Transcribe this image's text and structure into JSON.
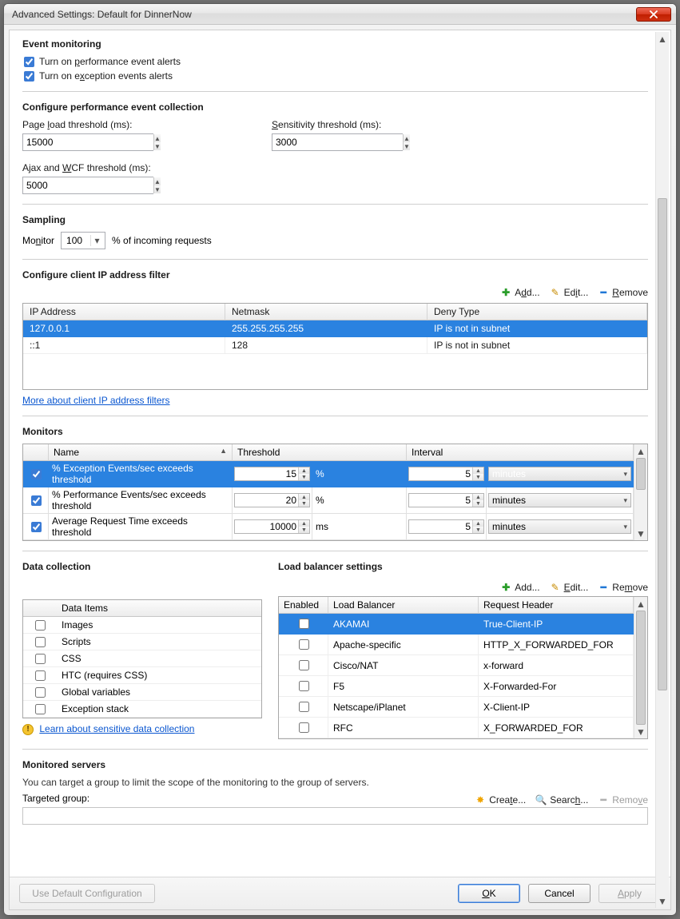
{
  "titlebar": {
    "title": "Advanced Settings: Default for DinnerNow"
  },
  "sections": {
    "event_monitoring": {
      "heading": "Event monitoring",
      "perf_alerts": "Turn on performance event alerts",
      "perf_alerts_uchar": "p",
      "exc_alerts": "Turn on exception events alerts",
      "exc_alerts_uchar": "x"
    },
    "perf_collection": {
      "heading": "Configure performance event collection",
      "page_load_label": "Page load threshold (ms):",
      "page_load_value": "15000",
      "sensitivity_label": "Sensitivity threshold (ms):",
      "sensitivity_value": "3000",
      "ajax_label": "Ajax and WCF threshold (ms):",
      "ajax_value": "5000"
    },
    "sampling": {
      "heading": "Sampling",
      "monitor_label": "Monitor",
      "monitor_value": "100",
      "suffix": "% of incoming requests"
    },
    "ip_filter": {
      "heading": "Configure client IP address filter",
      "actions": {
        "add": "Add...",
        "edit": "Edit...",
        "remove": "Remove"
      },
      "cols": {
        "ip": "IP Address",
        "netmask": "Netmask",
        "deny": "Deny Type"
      },
      "rows": [
        {
          "ip": "127.0.0.1",
          "netmask": "255.255.255.255",
          "deny": "IP is not in subnet"
        },
        {
          "ip": "::1",
          "netmask": "128",
          "deny": "IP is not in subnet"
        }
      ],
      "link": "More about client IP address filters"
    },
    "monitors": {
      "heading": "Monitors",
      "cols": {
        "name": "Name",
        "threshold": "Threshold",
        "interval": "Interval"
      },
      "rows": [
        {
          "checked": true,
          "name": "% Exception Events/sec exceeds threshold",
          "threshold": "15",
          "unit": "%",
          "interval": "5",
          "interval_unit": "minutes",
          "selected": true
        },
        {
          "checked": true,
          "name": "% Performance Events/sec exceeds threshold",
          "threshold": "20",
          "unit": "%",
          "interval": "5",
          "interval_unit": "minutes",
          "selected": false
        },
        {
          "checked": true,
          "name": "Average Request Time exceeds threshold",
          "threshold": "10000",
          "unit": "ms",
          "interval": "5",
          "interval_unit": "minutes",
          "selected": false
        }
      ]
    },
    "data_collection": {
      "heading": "Data collection",
      "col": "Data Items",
      "items": [
        "Images",
        "Scripts",
        "CSS",
        "HTC (requires CSS)",
        "Global variables",
        "Exception stack"
      ],
      "link": "Learn about sensitive data collection"
    },
    "load_balancer": {
      "heading": "Load balancer settings",
      "actions": {
        "add": "Add...",
        "edit": "Edit...",
        "remove": "Remove"
      },
      "cols": {
        "enabled": "Enabled",
        "lb": "Load Balancer",
        "header": "Request Header"
      },
      "rows": [
        {
          "enabled": false,
          "lb": "AKAMAI",
          "header": "True-Client-IP",
          "selected": true
        },
        {
          "enabled": false,
          "lb": "Apache-specific",
          "header": "HTTP_X_FORWARDED_FOR"
        },
        {
          "enabled": false,
          "lb": "Cisco/NAT",
          "header": "x-forward"
        },
        {
          "enabled": false,
          "lb": "F5",
          "header": "X-Forwarded-For"
        },
        {
          "enabled": false,
          "lb": "Netscape/iPlanet",
          "header": "X-Client-IP"
        },
        {
          "enabled": false,
          "lb": "RFC",
          "header": "X_FORWARDED_FOR"
        }
      ]
    },
    "monitored_servers": {
      "heading": "Monitored servers",
      "desc": "You can target a group to limit the scope of the monitoring to the group of servers.",
      "targeted_label": "Targeted group:",
      "actions": {
        "create": "Create...",
        "search": "Search...",
        "remove": "Remove"
      }
    }
  },
  "buttons": {
    "use_default": "Use Default Configuration",
    "ok": "OK",
    "cancel": "Cancel",
    "apply": "Apply"
  }
}
